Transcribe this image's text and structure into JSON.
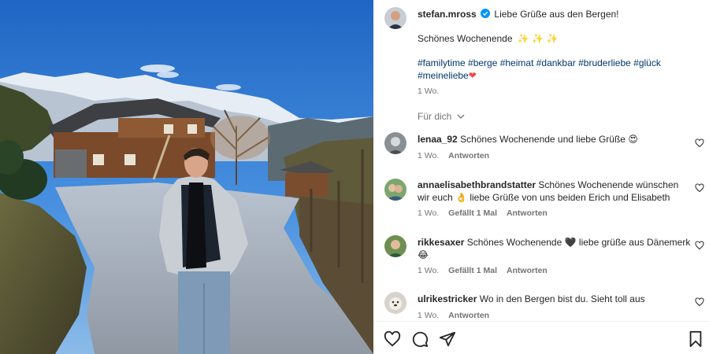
{
  "post": {
    "author": "stefan.mross",
    "caption_line1": "Liebe Grüße aus den Bergen!",
    "caption_line2": "Schönes Wochenende",
    "caption_line2_emoji": "✨ ✨ ✨",
    "hashtags_line1": "#familytime #berge #heimat #dankbar #bruderliebe #glück",
    "hashtags_line2": "#meineliebe",
    "hashtags_emoji": "❤",
    "time": "1 Wo."
  },
  "filter": {
    "label": "Für dich"
  },
  "comments": [
    {
      "user": "lenaa_92",
      "line1": "Schönes Wochenende und liebe Grüße",
      "emoji1": "😍",
      "line2": "",
      "time": "1 Wo.",
      "likes": "",
      "reply": "Antworten"
    },
    {
      "user": "annaelisabethbrandstatter",
      "line1": "Schönes Wochenende wünschen",
      "line2": "wir euch",
      "emoji2": "👌",
      "line2b": "liebe Grüße von uns beiden Erich und Elisabeth",
      "time": "1 Wo.",
      "likes": "Gefällt 1 Mal",
      "reply": "Antworten"
    },
    {
      "user": "rikkesaxer",
      "line1": "Schönes Wochenende",
      "emoji1": "🖤",
      "line1b": "liebe grüße aus Dänemerk",
      "emoji2": "😂",
      "time": "1 Wo.",
      "likes": "Gefällt 1 Mal",
      "reply": "Antworten"
    },
    {
      "user": "ulrikestricker",
      "line1": "Wo in den Bergen bist du. Sieht toll aus",
      "time": "1 Wo.",
      "likes": "",
      "reply": "Antworten"
    }
  ],
  "icons": {
    "like": "heart-outline-icon",
    "comment": "speech-bubble-icon",
    "share": "paper-plane-icon",
    "save": "bookmark-icon",
    "verified": "verified-badge-icon"
  },
  "colors": {
    "link": "#00376b",
    "verified": "#0095f6",
    "muted": "#737373",
    "heart": "#ed4956"
  }
}
